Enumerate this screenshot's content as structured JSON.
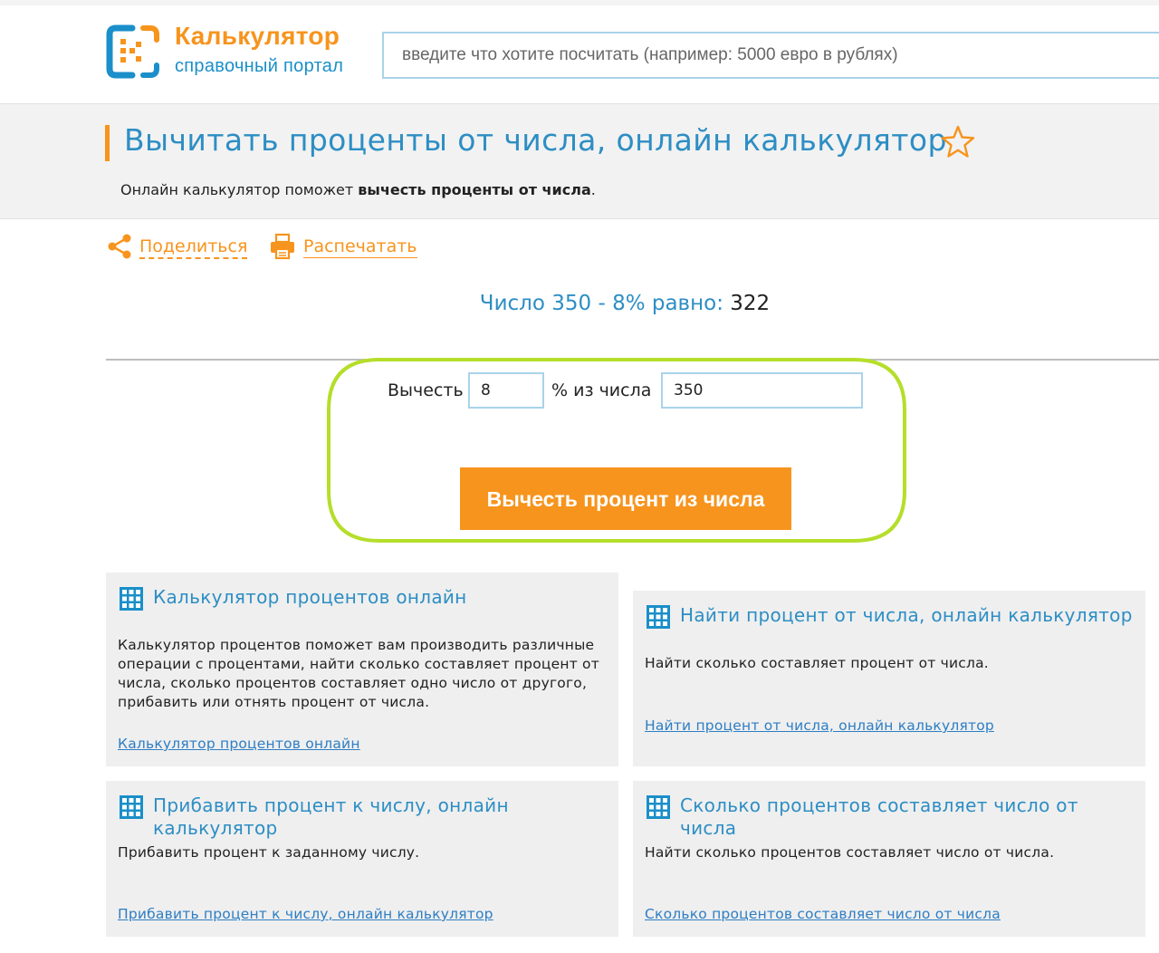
{
  "header": {
    "logo_title": "Калькулятор",
    "logo_subtitle": "справочный портал",
    "search_placeholder": "введите что хотите посчитать (например: 5000 евро в рублях)"
  },
  "page": {
    "title": "Вычитать проценты от числа, онлайн калькулятор",
    "desc_prefix": "Онлайн калькулятор поможет ",
    "desc_bold": "вычесть проценты от числа",
    "desc_suffix": "."
  },
  "actions": {
    "share_label": "Поделиться",
    "print_label": "Распечатать"
  },
  "result": {
    "label": "Число 350 - 8% равно: ",
    "value": "322"
  },
  "calculator": {
    "subtract_label": "Вычесть",
    "percent_value": "8",
    "of_number_label": "% из числа",
    "number_value": "350",
    "button_label": "Вычесть процент из числа"
  },
  "cards": [
    {
      "title": "Калькулятор процентов онлайн",
      "text": "Калькулятор процентов поможет вам производить различные операции с процентами, найти сколько составляет процент от числа, сколько процентов составляет одно число от другого, прибавить или отнять процент от числа.",
      "link": "Калькулятор процентов онлайн"
    },
    {
      "title": "Найти процент от числа, онлайн калькулятор",
      "text": "Найти сколько составляет процент от числа.",
      "link": "Найти процент от числа, онлайн калькулятор"
    },
    {
      "title": "Прибавить процент к числу, онлайн калькулятор",
      "text": "Прибавить процент к заданному числу.",
      "link": "Прибавить процент к числу, онлайн калькулятор"
    },
    {
      "title": "Сколько процентов составляет число от числа",
      "text": "Найти сколько процентов составляет число от числа.",
      "link": "Сколько процентов составляет число от числа"
    }
  ],
  "colors": {
    "accent_orange": "#f7941d",
    "title_blue": "#2d8ec4",
    "highlight_green": "#b5de2a"
  }
}
